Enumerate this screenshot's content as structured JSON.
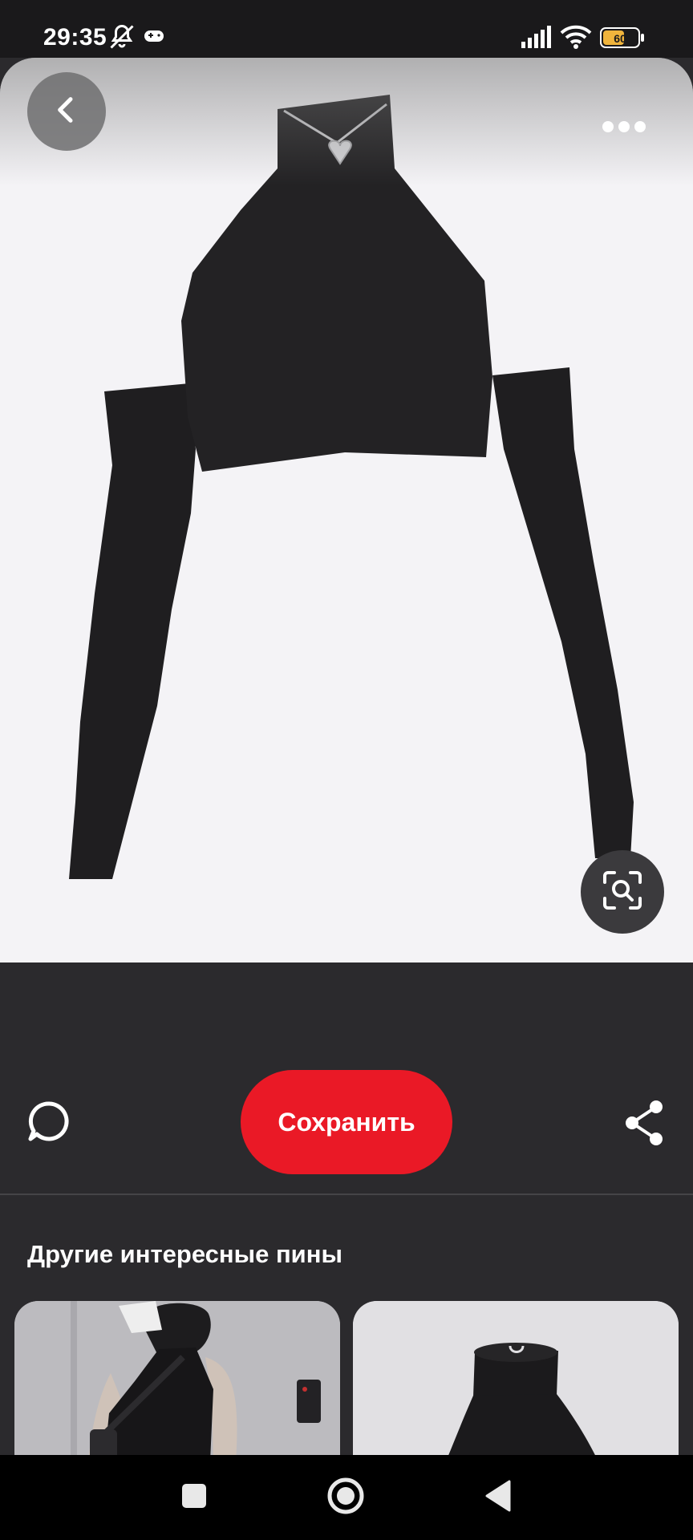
{
  "status_bar": {
    "time": "29:35",
    "battery_level": "60",
    "icons": [
      "notifications-muted-icon",
      "gamepad-icon",
      "signal-icon",
      "wifi-icon",
      "battery-icon"
    ]
  },
  "pin": {
    "image_alt": "Black halter crop top with detached long sleeves and heart pendant necklace",
    "back_icon": "chevron-left-icon",
    "more_icon": "more-horizontal-icon",
    "lens_icon": "visual-search-icon"
  },
  "actions": {
    "comment_icon": "comment-icon",
    "save_label": "Сохранить",
    "share_icon": "share-icon"
  },
  "more_pins": {
    "title": "Другие интересные пины",
    "items": [
      {
        "alt": "Person wearing black sleeveless turtleneck crop top"
      },
      {
        "alt": "Black turtleneck halter top"
      }
    ]
  },
  "nav": {
    "items": [
      "recent-apps-icon",
      "home-icon",
      "back-icon"
    ]
  },
  "colors": {
    "accent": "#ea1926",
    "background": "#2b2a2d",
    "image_bg": "#f4f3f6"
  }
}
